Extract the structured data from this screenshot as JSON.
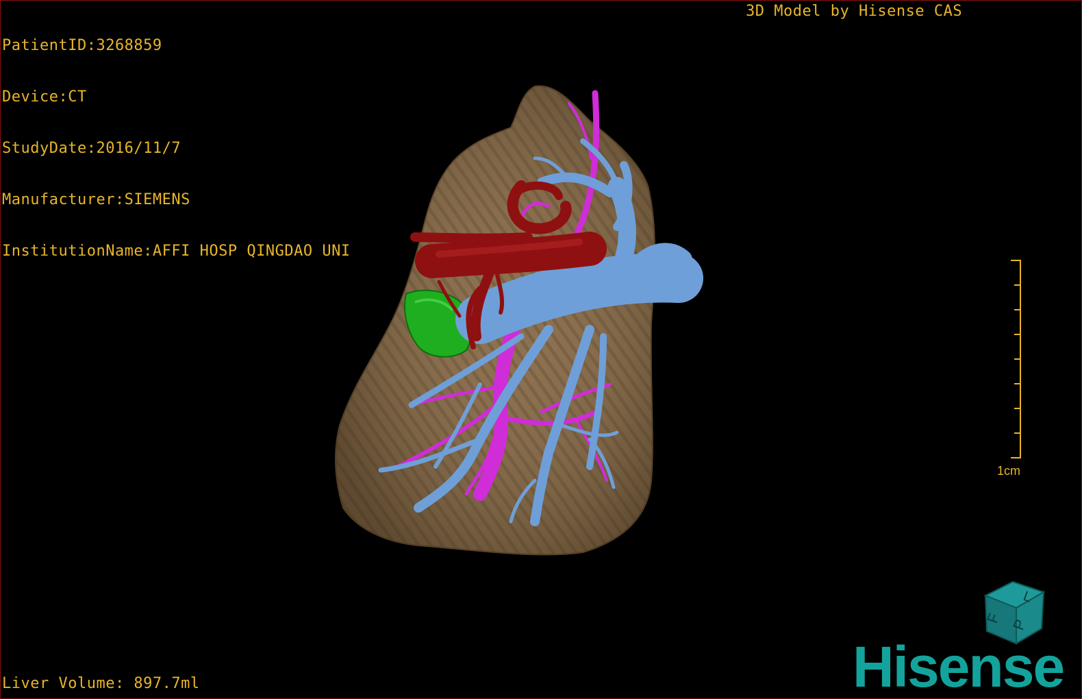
{
  "patient_info": {
    "patient_id": "PatientID:3268859",
    "device": "Device:CT",
    "study_date": "StudyDate:2016/11/7",
    "manufacturer": "Manufacturer:SIEMENS",
    "institution": "InstitutionName:AFFI HOSP QINGDAO UNI"
  },
  "model_credit": "3D Model by Hisense CAS",
  "liver_volume": "Liver Volume: 897.7ml",
  "scale_bar": {
    "label": "1cm",
    "color": "#e8b52a"
  },
  "orientation_cube": {
    "faces": [
      "F",
      "L",
      "P"
    ],
    "color": "#1a8a8a"
  },
  "brand": {
    "logo_text": "Hisense",
    "color": "#13a39c"
  },
  "anatomy_colors": {
    "liver": "#8c7150",
    "portal_vein": "#6f9fd8",
    "hepatic_artery": "#8f1010",
    "hepatic_vein": "#d02cd8",
    "lesion": "#1fae1f"
  }
}
